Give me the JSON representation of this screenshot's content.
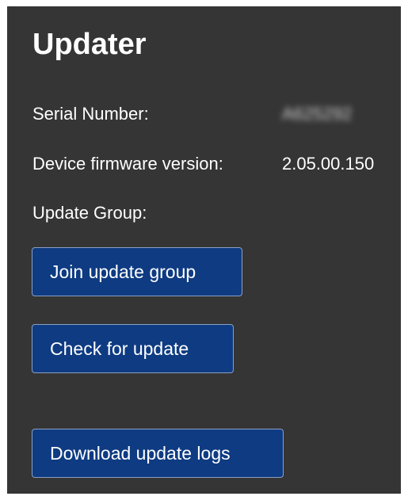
{
  "updater": {
    "title": "Updater",
    "serial_label": "Serial Number:",
    "serial_value": "A625292",
    "firmware_label": "Device firmware version:",
    "firmware_value": "2.05.00.150",
    "group_label": "Update Group:",
    "join_button": "Join update group",
    "check_button": "Check for update",
    "download_button": "Download update logs"
  },
  "colors": {
    "panel_background": "#353535",
    "button_background": "#0e3b82",
    "text": "#ffffff"
  }
}
